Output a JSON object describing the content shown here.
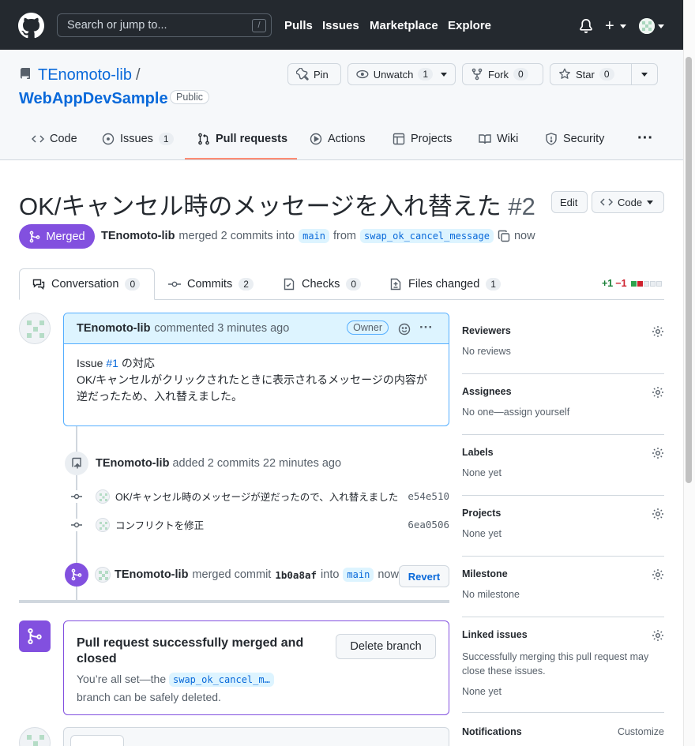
{
  "header": {
    "search_placeholder": "Search or jump to...",
    "search_shortcut": "/",
    "nav": [
      "Pulls",
      "Issues",
      "Marketplace",
      "Explore"
    ],
    "plus_icon": "plus-icon"
  },
  "repo": {
    "owner": "TEnomoto-lib",
    "separator": "/",
    "name": "WebAppDevSample",
    "visibility": "Public",
    "pin_label": "Pin",
    "unwatch_label": "Unwatch",
    "watch_count": "1",
    "fork_label": "Fork",
    "fork_count": "0",
    "star_label": "Star",
    "star_count": "0"
  },
  "tabs": {
    "code": "Code",
    "issues": "Issues",
    "issues_count": "1",
    "pulls": "Pull requests",
    "actions": "Actions",
    "projects": "Projects",
    "wiki": "Wiki",
    "security": "Security",
    "more": "···"
  },
  "pr": {
    "title": "OK/キャンセル時のメッセージを入れ替えた",
    "number": "#2",
    "edit_label": "Edit",
    "code_label": "Code",
    "state": "Merged",
    "author": "TEnomoto-lib",
    "merged_text": "merged 2 commits into",
    "base_branch": "main",
    "from_text": "from",
    "head_branch": "swap_ok_cancel_message",
    "time": "now"
  },
  "pr_tabs": {
    "conversation": "Conversation",
    "conversation_count": "0",
    "commits": "Commits",
    "commits_count": "2",
    "checks": "Checks",
    "checks_count": "0",
    "files": "Files changed",
    "files_count": "1",
    "additions": "+1",
    "deletions": "−1"
  },
  "comment": {
    "author": "TEnomoto-lib",
    "action": "commented 3 minutes ago",
    "role": "Owner",
    "line1_prefix": "Issue",
    "line1_link": "#1",
    "line1_suffix": "の対応",
    "line2": "OK/キャンセルがクリックされたときに表示されるメッセージの内容が",
    "line3": "逆だったため、入れ替えました。"
  },
  "timeline": {
    "added_author": "TEnomoto-lib",
    "added_text": "added 2 commits 22 minutes ago",
    "commits": [
      {
        "message": "OK/キャンセル時のメッセージが逆だったので、入れ替えました",
        "sha": "e54e510"
      },
      {
        "message": "コンフリクトを修正",
        "sha": "6ea0506"
      }
    ],
    "merge_author": "TEnomoto-lib",
    "merge_text": "merged commit",
    "merge_sha": "1b0a8af",
    "into_text": "into",
    "merge_branch": "main",
    "merge_time": "now",
    "revert_label": "Revert"
  },
  "merge_box": {
    "title": "Pull request successfully merged and closed",
    "desc_prefix": "You’re all set—the",
    "branch": "swap_ok_cancel_m…",
    "desc_suffix": "branch can be safely deleted.",
    "delete_label": "Delete branch"
  },
  "sidebar": {
    "reviewers": {
      "title": "Reviewers",
      "value": "No reviews"
    },
    "assignees": {
      "title": "Assignees",
      "value": "No one—assign yourself"
    },
    "labels": {
      "title": "Labels",
      "value": "None yet"
    },
    "projects": {
      "title": "Projects",
      "value": "None yet"
    },
    "milestone": {
      "title": "Milestone",
      "value": "No milestone"
    },
    "linked": {
      "title": "Linked issues",
      "desc": "Successfully merging this pull request may close these issues.",
      "value": "None yet"
    },
    "notifications": {
      "title": "Notifications",
      "action": "Customize"
    }
  },
  "colors": {
    "merged": "#8250df",
    "link": "#0969da",
    "header": "#24292f"
  }
}
